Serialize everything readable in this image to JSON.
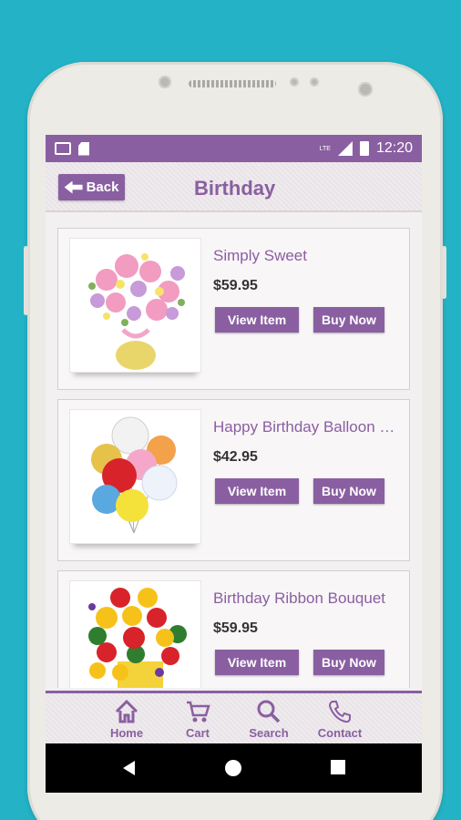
{
  "status_bar": {
    "time": "12:20",
    "network": "LTE",
    "icons": [
      "gmail-icon",
      "sd-card-icon",
      "signal-icon",
      "battery-charging-icon"
    ]
  },
  "header": {
    "back_label": "Back",
    "title": "Birthday"
  },
  "products": [
    {
      "name": "Simply Sweet",
      "price": "$59.95",
      "view_label": "View Item",
      "buy_label": "Buy Now",
      "image": "pink-lily-bouquet-in-yellow-vase"
    },
    {
      "name": "Happy Birthday Balloon Bo...",
      "price": "$42.95",
      "view_label": "View Item",
      "buy_label": "Buy Now",
      "image": "birthday-balloon-bouquet"
    },
    {
      "name": "Birthday Ribbon Bouquet",
      "price": "$59.95",
      "view_label": "View Item",
      "buy_label": "Buy Now",
      "image": "red-yellow-flower-bouquet"
    }
  ],
  "bottom_nav": [
    {
      "label": "Home",
      "icon": "home-icon"
    },
    {
      "label": "Cart",
      "icon": "cart-icon"
    },
    {
      "label": "Search",
      "icon": "search-icon"
    },
    {
      "label": "Contact",
      "icon": "phone-icon"
    }
  ],
  "colors": {
    "accent": "#8a5fa1",
    "background": "#24b3c6",
    "screen_bg": "#f3f0f1"
  }
}
